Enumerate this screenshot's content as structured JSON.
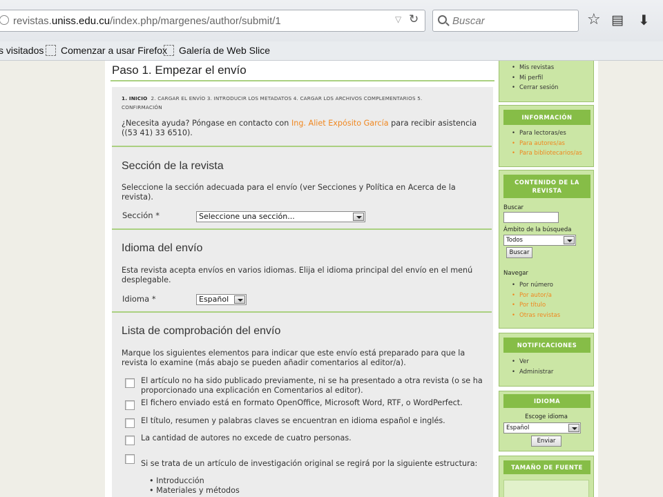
{
  "browser": {
    "url_prefix": "revistas.",
    "url_domain": "uniss.edu.cu",
    "url_path": "/index.php/margenes/author/submit/1",
    "search_placeholder": "Buscar",
    "bookmarks": [
      "s visitados",
      "Comenzar a usar Firefox",
      "Galería de Web Slice"
    ]
  },
  "page": {
    "title": "Paso 1. Empezar el envío",
    "steps": {
      "s1": "1. Inicio",
      "rest1": "2. Cargar el envío   3. Introducir los metadatos   4. Cargar los archivos complementarios   5.",
      "rest2": "Confirmación"
    },
    "help": {
      "pre": "¿Necesita ayuda? Póngase en contacto con ",
      "contact": "Ing. Aliet Expósito García",
      "post": " para recibir asistencia",
      "phone": "((53 41) 33 6510)."
    },
    "section": {
      "heading": "Sección de la revista",
      "text1_pre": "Seleccione la sección adecuada para el envío (ver Secciones y Política en ",
      "text1_link": "Acerca de la",
      "text2": "revista).",
      "label": "Sección *",
      "select_value": "Seleccione una sección..."
    },
    "language": {
      "heading": "Idioma del envío",
      "text1": "Esta revista acepta envíos en varios idiomas. Elija el idioma principal del envío en el menú",
      "text2": "desplegable.",
      "label": "Idioma *",
      "select_value": "Español"
    },
    "checklist": {
      "heading": "Lista de comprobación del envío",
      "intro1": "Marque los siguientes elementos para indicar que este envío está preparado para que la",
      "intro2": "revista lo examine (más abajo se pueden añadir comentarios al editor/a).",
      "items": [
        {
          "l1": "El artículo no ha sido publicado previamente, ni se ha presentado a otra revista (o se ha",
          "l2": "proporcionado una explicación en Comentarios al editor)."
        },
        {
          "l1": "El fichero enviado está en formato OpenOffice, Microsoft Word, RTF, o WordPerfect."
        },
        {
          "l1": "El título, resumen y palabras claves se encuentran en idioma español e inglés."
        },
        {
          "l1": "La cantidad de autores no excede de cuatro personas."
        },
        {
          "l1": "Si se trata de un artículo de investigación original se regirá por la siguiente estructura:"
        }
      ],
      "bullets": [
        "Introducción",
        "Materiales y métodos"
      ]
    }
  },
  "sidebar": {
    "user_links": [
      "Mis revistas",
      "Mi perfil",
      "Cerrar sesión"
    ],
    "info": {
      "title": "INFORMACIÓN",
      "links": [
        "Para lectoras/es",
        "Para autores/as",
        "Para bibliotecarios/as"
      ]
    },
    "content": {
      "title1": "CONTENIDO DE LA",
      "title2": "REVISTA",
      "search_label": "Buscar",
      "scope_label": "Ámbito de la búsqueda",
      "scope_value": "Todos",
      "search_button": "Buscar",
      "browse_label": "Navegar",
      "browse_links": [
        "Por número",
        "Por autor/a",
        "Por título",
        "Otras revistas"
      ]
    },
    "notifications": {
      "title": "NOTIFICACIONES",
      "links": [
        "Ver",
        "Administrar"
      ]
    },
    "language": {
      "title": "IDIOMA",
      "label": "Escoge idioma",
      "value": "Español",
      "button": "Enviar"
    },
    "font_size": {
      "title": "TAMAÑO DE FUENTE"
    }
  }
}
